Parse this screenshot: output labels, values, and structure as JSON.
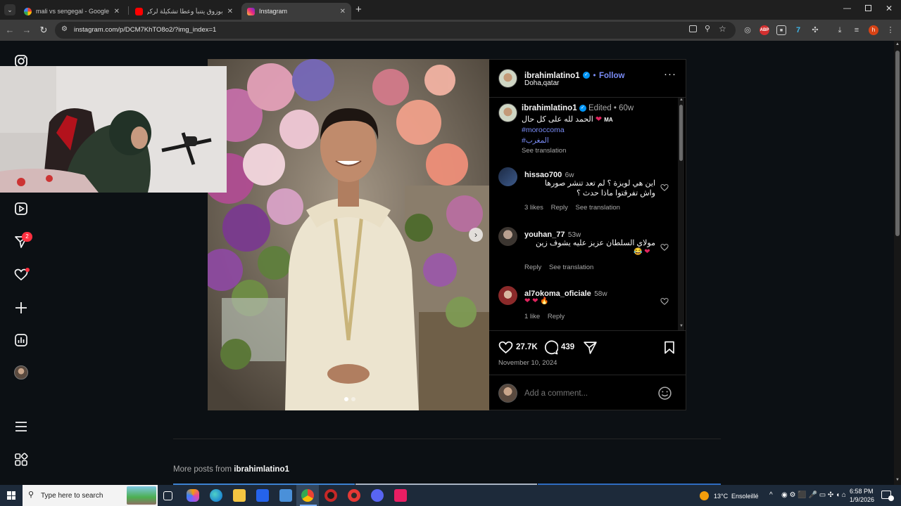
{
  "browser": {
    "tabs": [
      {
        "title": "mali vs sengegal - Google Search"
      },
      {
        "title": "بوزوق يتنبأ وعطا تشكيلة لركراكي"
      },
      {
        "title": "Instagram"
      }
    ],
    "url": "instagram.com/p/DCM7KhTO8o2/?img_index=1"
  },
  "sidebar": {
    "notifications_badge": "2"
  },
  "post": {
    "author": "ibrahimlatino1",
    "follow_label": "Follow",
    "location": "Doha,qatar",
    "caption": {
      "username": "ibrahimlatino1",
      "edited": "Edited",
      "time": "60w",
      "text": "الحمد لله على كل حال",
      "suffix": "MA",
      "hashtag1": "#moroccoma",
      "hashtag2": "#المغرب",
      "see_translation": "See translation"
    },
    "comments": [
      {
        "username": "hissao700",
        "time": "6w",
        "line1": "اين هي لويزة ؟ لم تعد تنشر صورها",
        "line2": "واش تفرقتوا ماذا حدث ؟",
        "likes": "3 likes",
        "reply": "Reply",
        "translate": "See translation"
      },
      {
        "username": "youhan_77",
        "time": "53w",
        "line1": "مولاي السلطان عزيز عليه يشوف زين",
        "reply": "Reply",
        "translate": "See translation"
      },
      {
        "username": "al7okoma_oficiale",
        "time": "58w",
        "likes": "1 like",
        "reply": "Reply"
      }
    ],
    "like_count": "27.7K",
    "comment_count": "439",
    "date": "November 10, 2024",
    "comment_placeholder": "Add a comment..."
  },
  "more_posts": {
    "prefix": "More posts from",
    "username": "ibrahimlatino1"
  },
  "taskbar": {
    "search_placeholder": "Type here to search",
    "temperature": "13°C",
    "weather": "Ensoleillé",
    "time": "6:58 PM",
    "date": "1/9/2026"
  }
}
